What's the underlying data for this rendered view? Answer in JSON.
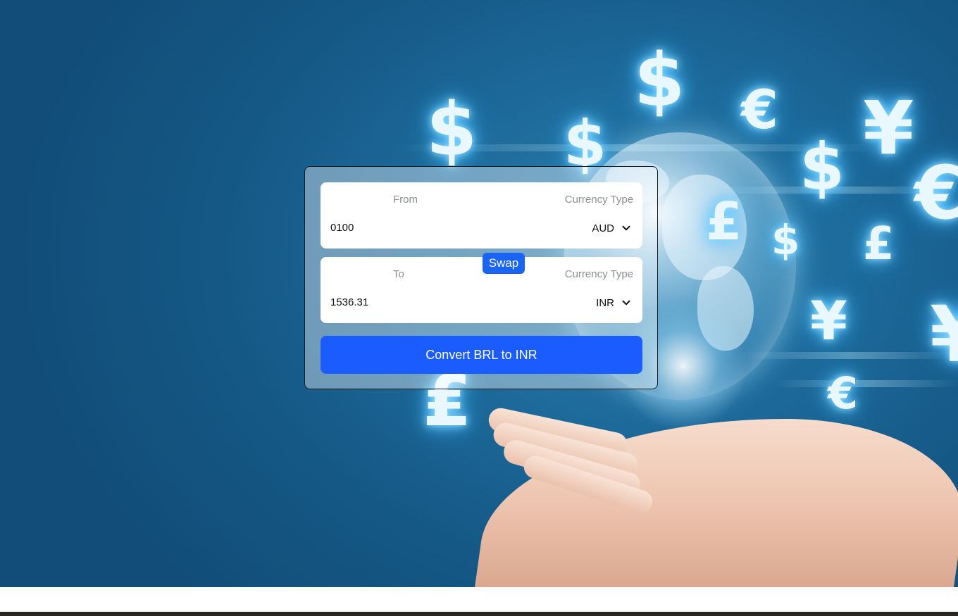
{
  "converter": {
    "from": {
      "label": "From",
      "amount": "0100",
      "currency_label": "Currency Type",
      "currency": "AUD"
    },
    "swap_label": "Swap",
    "to": {
      "label": "To",
      "amount": "1536.31",
      "currency_label": "Currency Type",
      "currency": "INR"
    },
    "convert_label": "Convert BRL to INR"
  },
  "background": {
    "symbols": [
      "$",
      "$",
      "$",
      "€",
      "¥",
      "$",
      "£",
      "$",
      "£",
      "¥",
      "€",
      "€",
      "¥",
      "₤"
    ]
  },
  "colors": {
    "accent": "#1a5cff",
    "swap": "#1a63f5",
    "label": "#8a8f94"
  },
  "icons": {
    "dropdown": "chevron-down-icon"
  }
}
